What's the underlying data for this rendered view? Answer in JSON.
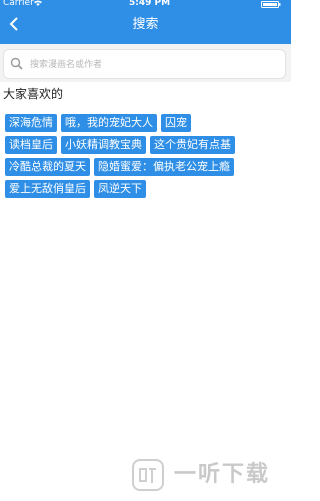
{
  "status_bar": {
    "carrier": "Carrier",
    "time": "5:49 PM"
  },
  "header": {
    "title": "搜索",
    "back_icon": "chevron-left-icon"
  },
  "search": {
    "placeholder": "搜索漫画名或作者",
    "value": ""
  },
  "section": {
    "title": "大家喜欢的"
  },
  "tags": [
    [
      "深海危情",
      "哦，我的宠妃大人",
      "囚宠"
    ],
    [
      "读档皇后",
      "小妖精调教宝典",
      "这个贵妃有点基"
    ],
    [
      "冷酷总裁的夏天",
      "隐婚蜜爱：偏执老公宠上瘾"
    ],
    [
      "爱上无敌俏皇后",
      "凤逆天下"
    ]
  ],
  "watermark": {
    "text": "一听下载"
  },
  "colors": {
    "accent": "#2f8fe6",
    "search_bg": "#f3f3f3"
  }
}
